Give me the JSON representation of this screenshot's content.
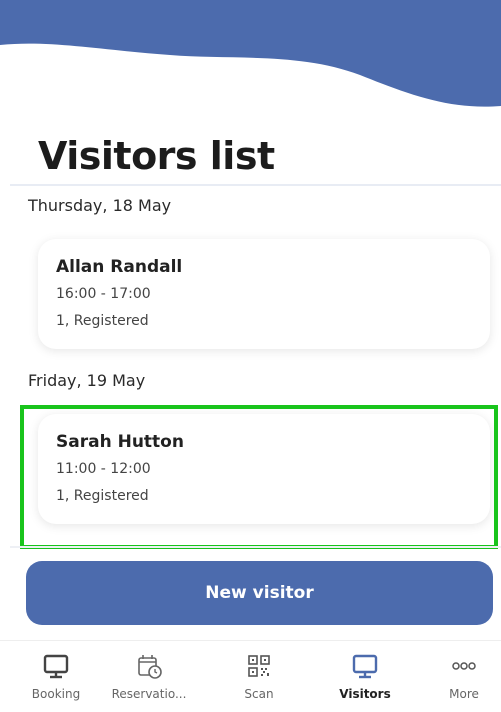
{
  "page": {
    "title": "Visitors list",
    "accent_color": "#4c6bad",
    "highlight_color": "#19c41c"
  },
  "groups": [
    {
      "date": "Thursday, 18 May",
      "visits": [
        {
          "name": "Allan Randall",
          "time": "16:00 - 17:00",
          "status": "1, Registered"
        }
      ]
    },
    {
      "date": "Friday, 19 May",
      "visits": [
        {
          "name": "Sarah Hutton",
          "time": "11:00 - 12:00",
          "status": "1, Registered"
        }
      ]
    }
  ],
  "actions": {
    "new_visitor_label": "New visitor"
  },
  "tabbar": {
    "items": [
      {
        "label": "Booking",
        "icon": "monitor-icon",
        "active": false
      },
      {
        "label": "Reservatio...",
        "icon": "calendar-clock-icon",
        "active": false
      },
      {
        "label": "Scan",
        "icon": "qr-code-icon",
        "active": false
      },
      {
        "label": "Visitors",
        "icon": "monitor-icon",
        "active": true
      },
      {
        "label": "More",
        "icon": "more-icon",
        "active": false
      }
    ]
  }
}
